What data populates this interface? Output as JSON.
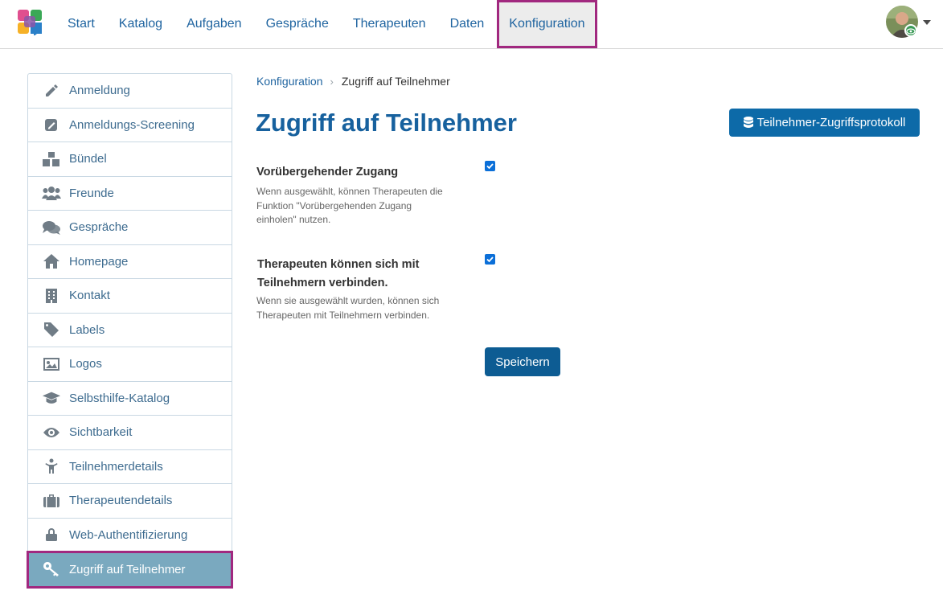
{
  "nav": {
    "items": [
      {
        "label": "Start"
      },
      {
        "label": "Katalog"
      },
      {
        "label": "Aufgaben"
      },
      {
        "label": "Gespräche"
      },
      {
        "label": "Therapeuten"
      },
      {
        "label": "Daten"
      },
      {
        "label": "Konfiguration"
      }
    ],
    "active": "Konfiguration"
  },
  "sidebar": {
    "items": [
      {
        "label": "Anmeldung",
        "icon": "pencil-icon"
      },
      {
        "label": "Anmeldungs-Screening",
        "icon": "edit-square-icon"
      },
      {
        "label": "Bündel",
        "icon": "cubes-icon"
      },
      {
        "label": "Freunde",
        "icon": "users-icon"
      },
      {
        "label": "Gespräche",
        "icon": "comments-icon"
      },
      {
        "label": "Homepage",
        "icon": "home-icon"
      },
      {
        "label": "Kontakt",
        "icon": "building-icon"
      },
      {
        "label": "Labels",
        "icon": "tag-icon"
      },
      {
        "label": "Logos",
        "icon": "image-icon"
      },
      {
        "label": "Selbsthilfe-Katalog",
        "icon": "graduation-cap-icon"
      },
      {
        "label": "Sichtbarkeit",
        "icon": "eye-icon"
      },
      {
        "label": "Teilnehmerdetails",
        "icon": "child-icon"
      },
      {
        "label": "Therapeutendetails",
        "icon": "suitcase-icon"
      },
      {
        "label": "Web-Authentifizierung",
        "icon": "lock-icon"
      },
      {
        "label": "Zugriff auf Teilnehmer",
        "icon": "key-icon"
      }
    ],
    "active": "Zugriff auf Teilnehmer"
  },
  "breadcrumb": {
    "parent": "Konfiguration",
    "separator": "›",
    "current": "Zugriff auf Teilnehmer"
  },
  "page": {
    "title": "Zugriff auf Teilnehmer",
    "log_button": "Teilnehmer-Zugriffsprotokoll",
    "save_button": "Speichern"
  },
  "settings": [
    {
      "label": "Vorübergehender Zugang",
      "help_lines": [
        "Wenn ausgewählt, können Therapeuten die",
        "Funktion \"Vorübergehenden Zugang",
        "einholen\" nutzen."
      ],
      "checked": true
    },
    {
      "label_lines": [
        "Therapeuten können sich mit",
        "Teilnehmern verbinden."
      ],
      "help_lines": [
        "Wenn sie ausgewählt wurden, können sich",
        "Therapeuten mit Teilnehmern verbinden."
      ],
      "checked": true
    }
  ],
  "colors": {
    "primary": "#1f64a0",
    "button": "#0d6aa8",
    "highlight": "#a1287f",
    "active_sidebar": "#7aa9bf"
  }
}
